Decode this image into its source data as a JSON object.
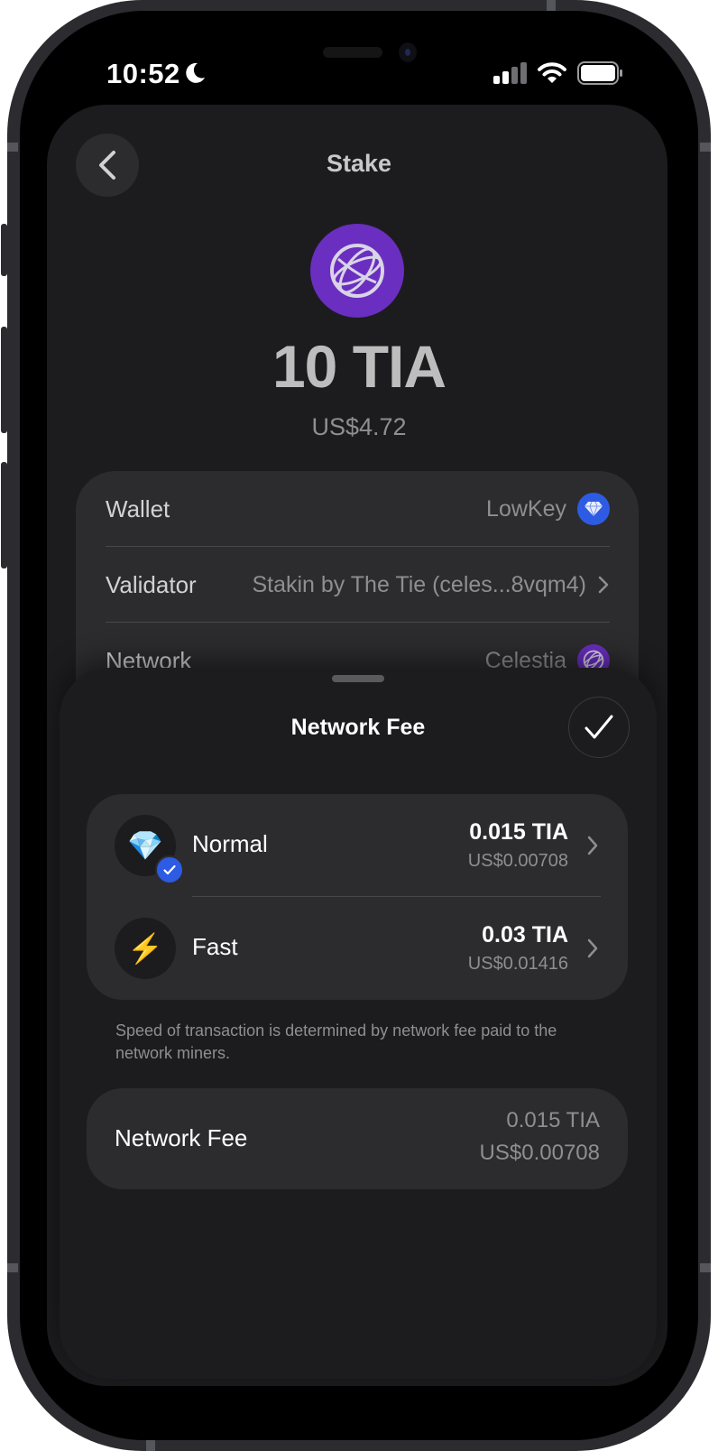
{
  "status_bar": {
    "time": "10:52"
  },
  "header": {
    "title": "Stake"
  },
  "stake": {
    "amount": "10 TIA",
    "amount_usd": "US$4.72"
  },
  "details": [
    {
      "label": "Wallet",
      "value": "LowKey",
      "icon": "wallet-gem-icon"
    },
    {
      "label": "Validator",
      "value": "Stakin by The Tie (celes...8vqm4)",
      "icon": "chevron-right-icon"
    },
    {
      "label": "Network",
      "value": "Celestia",
      "icon": "celestia-icon"
    }
  ],
  "sheet": {
    "title": "Network Fee",
    "options": [
      {
        "name": "Normal",
        "amount": "0.015 TIA",
        "usd": "US$0.00708",
        "icon": "gem-icon",
        "selected": true
      },
      {
        "name": "Fast",
        "amount": "0.03 TIA",
        "usd": "US$0.01416",
        "icon": "lightning-icon",
        "selected": false
      }
    ],
    "note": "Speed of transaction is determined by network fee paid to the network miners.",
    "summary": {
      "label": "Network Fee",
      "amount": "0.015 TIA",
      "usd": "US$0.00708"
    }
  },
  "colors": {
    "accent": "#2d5be3",
    "celestia": "#6a2ec0",
    "card": "#2c2c2e",
    "background": "#1c1c1e"
  }
}
